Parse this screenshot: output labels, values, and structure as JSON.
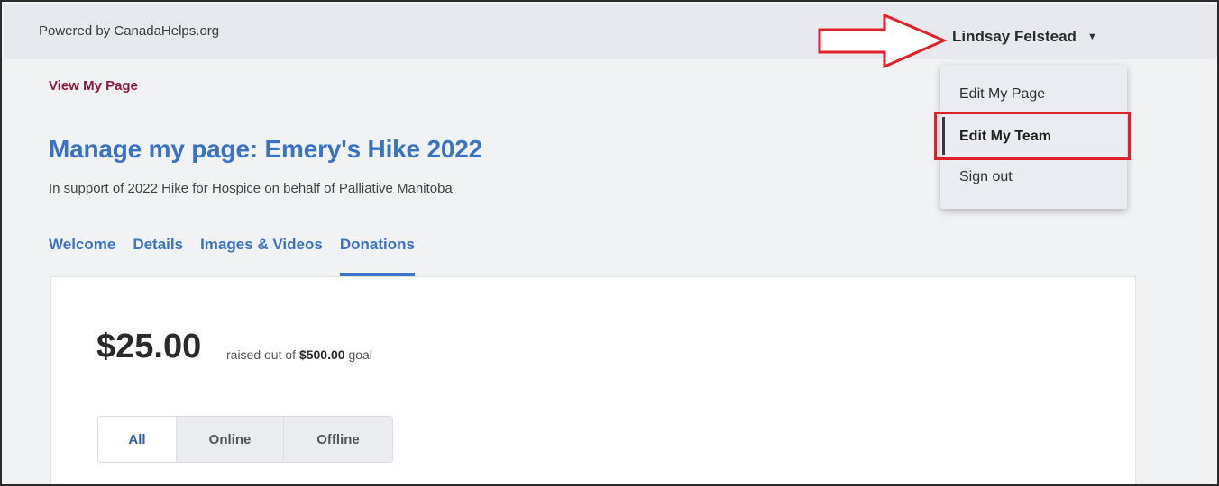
{
  "topbar": {
    "powered_by": "Powered by CanadaHelps.org",
    "user_name": "Lindsay Felstead",
    "caret_icon": "▼"
  },
  "colors": {
    "brand_blue": "#3a73c6",
    "link_maroon": "#8c1a3c",
    "annotation_red": "#e0202a"
  },
  "header": {
    "view_link": "View My Page",
    "title": "Manage my page: Emery's Hike 2022",
    "subtitle": "In support of 2022 Hike for Hospice on behalf of Palliative Manitoba"
  },
  "tabs": [
    {
      "label": "Welcome",
      "active": false
    },
    {
      "label": "Details",
      "active": false
    },
    {
      "label": "Images & Videos",
      "active": false
    },
    {
      "label": "Donations",
      "active": true
    }
  ],
  "donations": {
    "amount": "$25.00",
    "raised_prefix": "raised out of",
    "goal": "$500.00",
    "raised_suffix": "goal",
    "filters": [
      {
        "label": "All",
        "active": true
      },
      {
        "label": "Online",
        "active": false
      },
      {
        "label": "Offline",
        "active": false
      }
    ]
  },
  "dropdown": {
    "items": [
      {
        "label": "Edit My Page",
        "active": false
      },
      {
        "label": "Edit My Team",
        "active": true
      },
      {
        "label": "Sign out",
        "active": false
      }
    ]
  },
  "annotations": {
    "arrow_icon": "red-outline-arrow-icon"
  }
}
